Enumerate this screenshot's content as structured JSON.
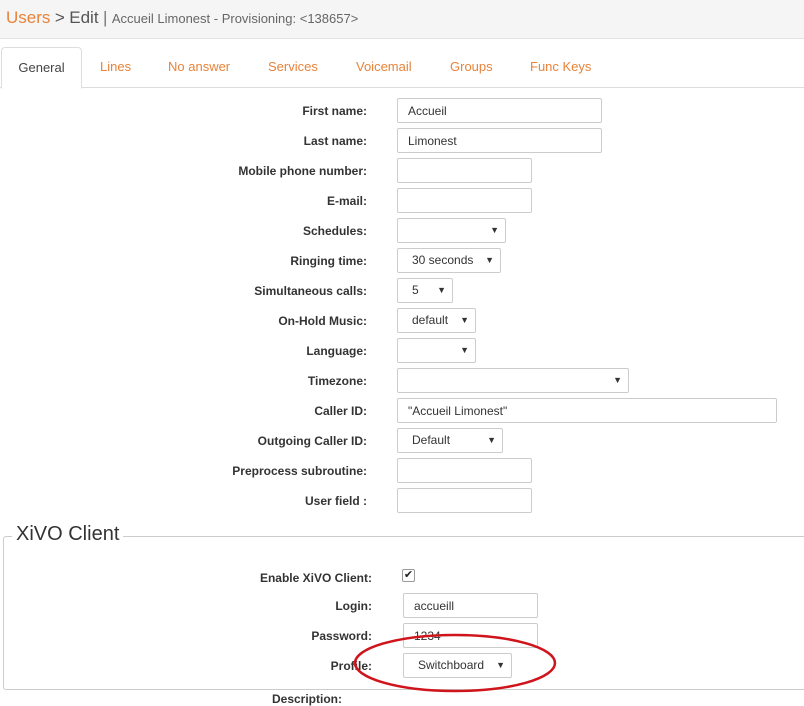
{
  "breadcrumb": {
    "root": "Users",
    "sep": ">",
    "current": "Edit",
    "pipe": "|",
    "subtitle": "Accueil Limonest - Provisioning: <138657>"
  },
  "tabs": [
    {
      "label": "General",
      "active": true
    },
    {
      "label": "Lines"
    },
    {
      "label": "No answer"
    },
    {
      "label": "Services"
    },
    {
      "label": "Voicemail"
    },
    {
      "label": "Groups"
    },
    {
      "label": "Func Keys"
    }
  ],
  "form": {
    "first_name": {
      "label": "First name:",
      "value": "Accueil"
    },
    "last_name": {
      "label": "Last name:",
      "value": "Limonest"
    },
    "mobile": {
      "label": "Mobile phone number:",
      "value": ""
    },
    "email": {
      "label": "E-mail:",
      "value": ""
    },
    "schedules": {
      "label": "Schedules:",
      "value": ""
    },
    "ringing_time": {
      "label": "Ringing time:",
      "value": "30 seconds"
    },
    "simultaneous_calls": {
      "label": "Simultaneous calls:",
      "value": "5"
    },
    "onhold_music": {
      "label": "On-Hold Music:",
      "value": "default"
    },
    "language": {
      "label": "Language:",
      "value": ""
    },
    "timezone": {
      "label": "Timezone:",
      "value": ""
    },
    "caller_id": {
      "label": "Caller ID:",
      "value": "\"Accueil Limonest\""
    },
    "outgoing_caller_id": {
      "label": "Outgoing Caller ID:",
      "value": "Default"
    },
    "preprocess": {
      "label": "Preprocess subroutine:",
      "value": ""
    },
    "user_field": {
      "label": "User field :",
      "value": ""
    }
  },
  "client": {
    "legend": "XiVO Client",
    "enable": {
      "label": "Enable XiVO Client:",
      "checked": true
    },
    "login": {
      "label": "Login:",
      "value": "accueill"
    },
    "password": {
      "label": "Password:",
      "value": "1234"
    },
    "profile": {
      "label": "Profile:",
      "value": "Switchboard"
    },
    "description": {
      "label": "Description:"
    }
  },
  "colors": {
    "accent": "#e8833a",
    "annotation": "#d0141c"
  },
  "icons": {
    "caret": "dropdown-caret-icon",
    "check": "checkmark-icon"
  }
}
